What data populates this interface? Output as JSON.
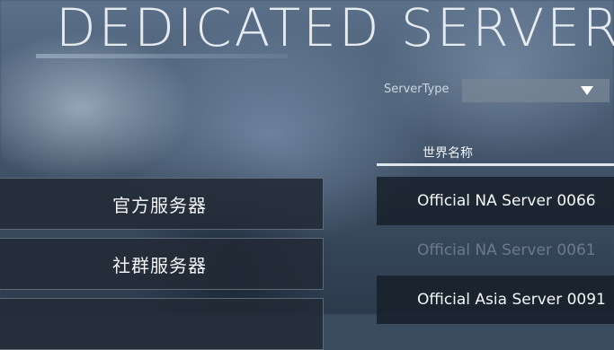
{
  "title": "DEDICATED SERVER",
  "server_type": {
    "label": "ServerType",
    "value": ""
  },
  "list_header": "世界名称",
  "menu": [
    {
      "label": "官方服务器"
    },
    {
      "label": "社群服务器"
    },
    {
      "label": ""
    }
  ],
  "servers": [
    {
      "name": "Official NA Server 0066",
      "state": "selected"
    },
    {
      "name": "Official NA Server 0061",
      "state": "dimmed"
    },
    {
      "name": "Official Asia Server 0091",
      "state": "normal"
    }
  ]
}
